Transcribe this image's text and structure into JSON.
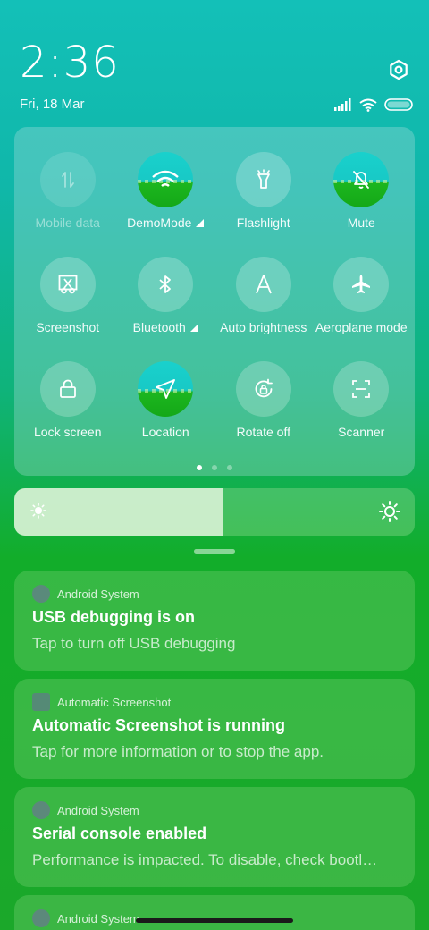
{
  "header": {
    "time": "2:36",
    "date": "Fri, 18 Mar"
  },
  "status_icons": [
    "signal-icon",
    "wifi-icon",
    "battery-icon"
  ],
  "quick_settings": {
    "tiles": [
      {
        "label": "Mobile data",
        "icon": "mobile-data-icon",
        "state": "disabled"
      },
      {
        "label": "DemoMode",
        "icon": "wifi-icon",
        "state": "active",
        "expandable": true
      },
      {
        "label": "Flashlight",
        "icon": "flashlight-icon",
        "state": "off"
      },
      {
        "label": "Mute",
        "icon": "bell-off-icon",
        "state": "active"
      },
      {
        "label": "Screenshot",
        "icon": "screenshot-icon",
        "state": "off"
      },
      {
        "label": "Bluetooth",
        "icon": "bluetooth-icon",
        "state": "off",
        "expandable": true
      },
      {
        "label": "Auto brightness",
        "icon": "auto-brightness-icon",
        "state": "off"
      },
      {
        "label": "Aeroplane mode",
        "icon": "airplane-icon",
        "state": "off"
      },
      {
        "label": "Lock screen",
        "icon": "lock-icon",
        "state": "off"
      },
      {
        "label": "Location",
        "icon": "location-icon",
        "state": "active"
      },
      {
        "label": "Rotate off",
        "icon": "rotate-lock-icon",
        "state": "off"
      },
      {
        "label": "Scanner",
        "icon": "scanner-icon",
        "state": "off"
      }
    ],
    "pages": 3,
    "current_page": 1
  },
  "brightness": {
    "level": 0.52
  },
  "notifications": [
    {
      "app": "Android System",
      "title": "USB debugging is on",
      "text": "Tap to turn off USB debugging"
    },
    {
      "app": "Automatic Screenshot",
      "title": "Automatic Screenshot is running",
      "text": "Tap for more information or to stop the app."
    },
    {
      "app": "Android System",
      "title": "Serial console enabled",
      "text": "Performance is impacted. To disable, check bootl…"
    },
    {
      "app": "Android System",
      "title": "",
      "text": ""
    }
  ],
  "colors": {
    "accent_active_top": "#19d1cc",
    "accent_active_bottom": "#14a818"
  }
}
